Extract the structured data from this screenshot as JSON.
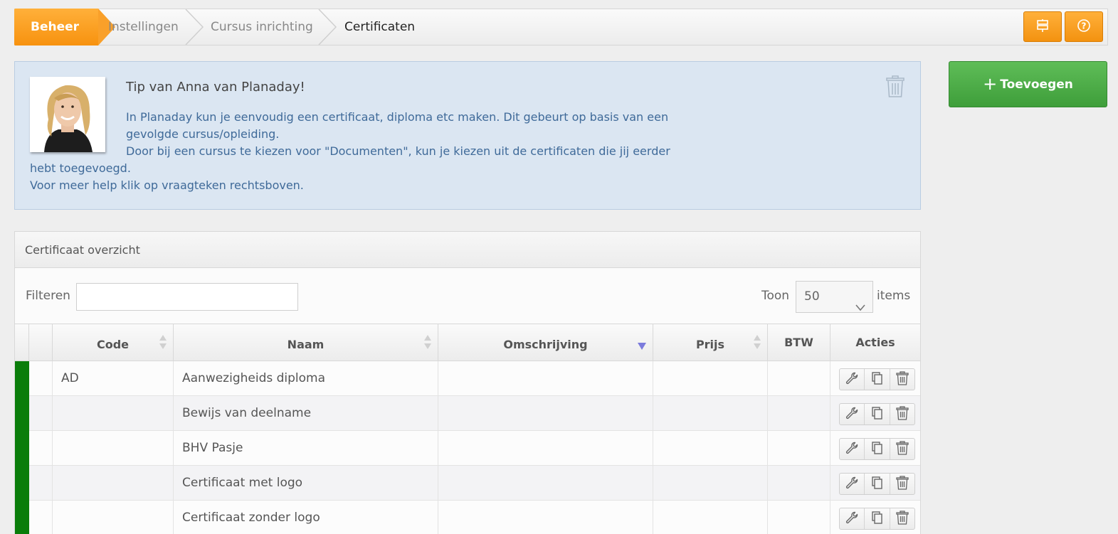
{
  "breadcrumb": {
    "home": "Beheer",
    "items": [
      "Instellingen",
      "Cursus inrichting",
      "Certificaten"
    ]
  },
  "topbar_buttons": [
    {
      "icon": "signpost-icon"
    },
    {
      "icon": "help-icon"
    }
  ],
  "tip": {
    "title": "Tip van Anna van Planaday!",
    "line1": "In Planaday kun je eenvoudig een certificaat, diploma etc maken. Dit gebeurt op basis van een gevolgde cursus/opleiding.",
    "line2": "Door bij een cursus te kiezen voor \"Documenten\", kun je kiezen uit de certificaten die jij eerder hebt toegevoegd.",
    "line3": "Voor meer help klik op vraagteken rechtsboven."
  },
  "add_button": {
    "plus": "+",
    "label": "Toevoegen"
  },
  "panel": {
    "title": "Certificaat overzicht",
    "filter_label": "Filteren",
    "filter_value": "",
    "show_label": "Toon",
    "show_value": "50",
    "items_label": "items"
  },
  "table": {
    "columns": [
      "Code",
      "Naam",
      "Omschrijving",
      "Prijs",
      "BTW",
      "Acties"
    ],
    "rows": [
      {
        "code": "AD",
        "naam": "Aanwezigheids diploma",
        "omschrijving": "",
        "prijs": "",
        "btw": ""
      },
      {
        "code": "",
        "naam": "Bewijs van deelname",
        "omschrijving": "",
        "prijs": "",
        "btw": ""
      },
      {
        "code": "",
        "naam": "BHV Pasje",
        "omschrijving": "",
        "prijs": "",
        "btw": ""
      },
      {
        "code": "",
        "naam": "Certificaat met logo",
        "omschrijving": "",
        "prijs": "",
        "btw": ""
      },
      {
        "code": "",
        "naam": "Certificaat zonder logo",
        "omschrijving": "",
        "prijs": "",
        "btw": ""
      }
    ]
  },
  "colors": {
    "accent_orange": "#f7920f",
    "add_green": "#4caf50",
    "status_green": "#0a7d0a",
    "tip_bg": "#dbe6f2",
    "tip_text": "#3f6a99"
  }
}
